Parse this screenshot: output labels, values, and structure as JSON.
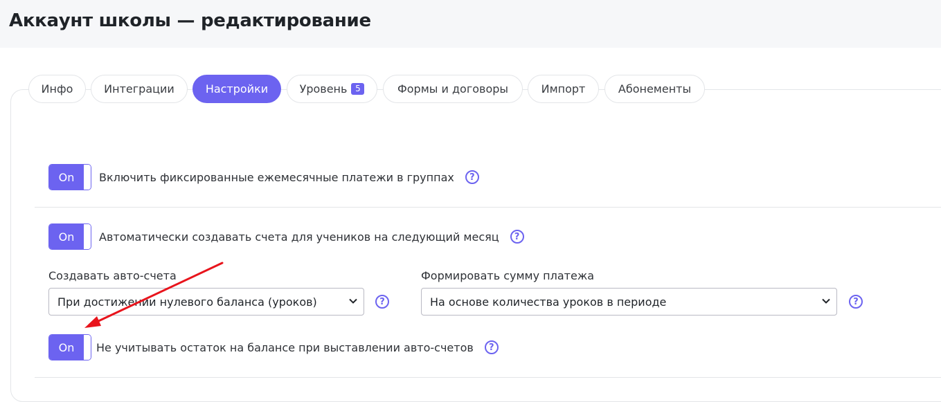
{
  "header": {
    "title": "Аккаунт школы — редактирование"
  },
  "tabs": [
    {
      "label": "Инфо",
      "active": false
    },
    {
      "label": "Интеграции",
      "active": false
    },
    {
      "label": "Настройки",
      "active": true
    },
    {
      "label": "Уровень",
      "badge": "5",
      "active": false
    },
    {
      "label": "Формы и договоры",
      "active": false
    },
    {
      "label": "Импорт",
      "active": false
    },
    {
      "label": "Абонементы",
      "active": false
    }
  ],
  "settings": {
    "fixed_payments": {
      "toggle_label": "On",
      "label": "Включить фиксированные ежемесячные платежи в группах",
      "help": "?"
    },
    "auto_invoices": {
      "toggle_label": "On",
      "label": "Автоматически создавать счета для учеников на следующий месяц",
      "help": "?"
    },
    "create_invoices": {
      "label": "Создавать авто-счета",
      "value": "При достижении нулевого баланса (уроков)",
      "help": "?"
    },
    "payment_amount": {
      "label": "Формировать сумму платежа",
      "value": "На основе количества уроков в периоде",
      "help": "?"
    },
    "ignore_balance": {
      "toggle_label": "On",
      "label": "Не учитывать остаток на балансе при выставлении авто-счетов",
      "help": "?"
    }
  },
  "colors": {
    "accent": "#6c63f0",
    "annotation_arrow": "#e8141c",
    "header_bg": "#f6f7f9"
  },
  "icons": {
    "help": "question-circle-icon",
    "select_caret": "chevron-down-icon"
  }
}
